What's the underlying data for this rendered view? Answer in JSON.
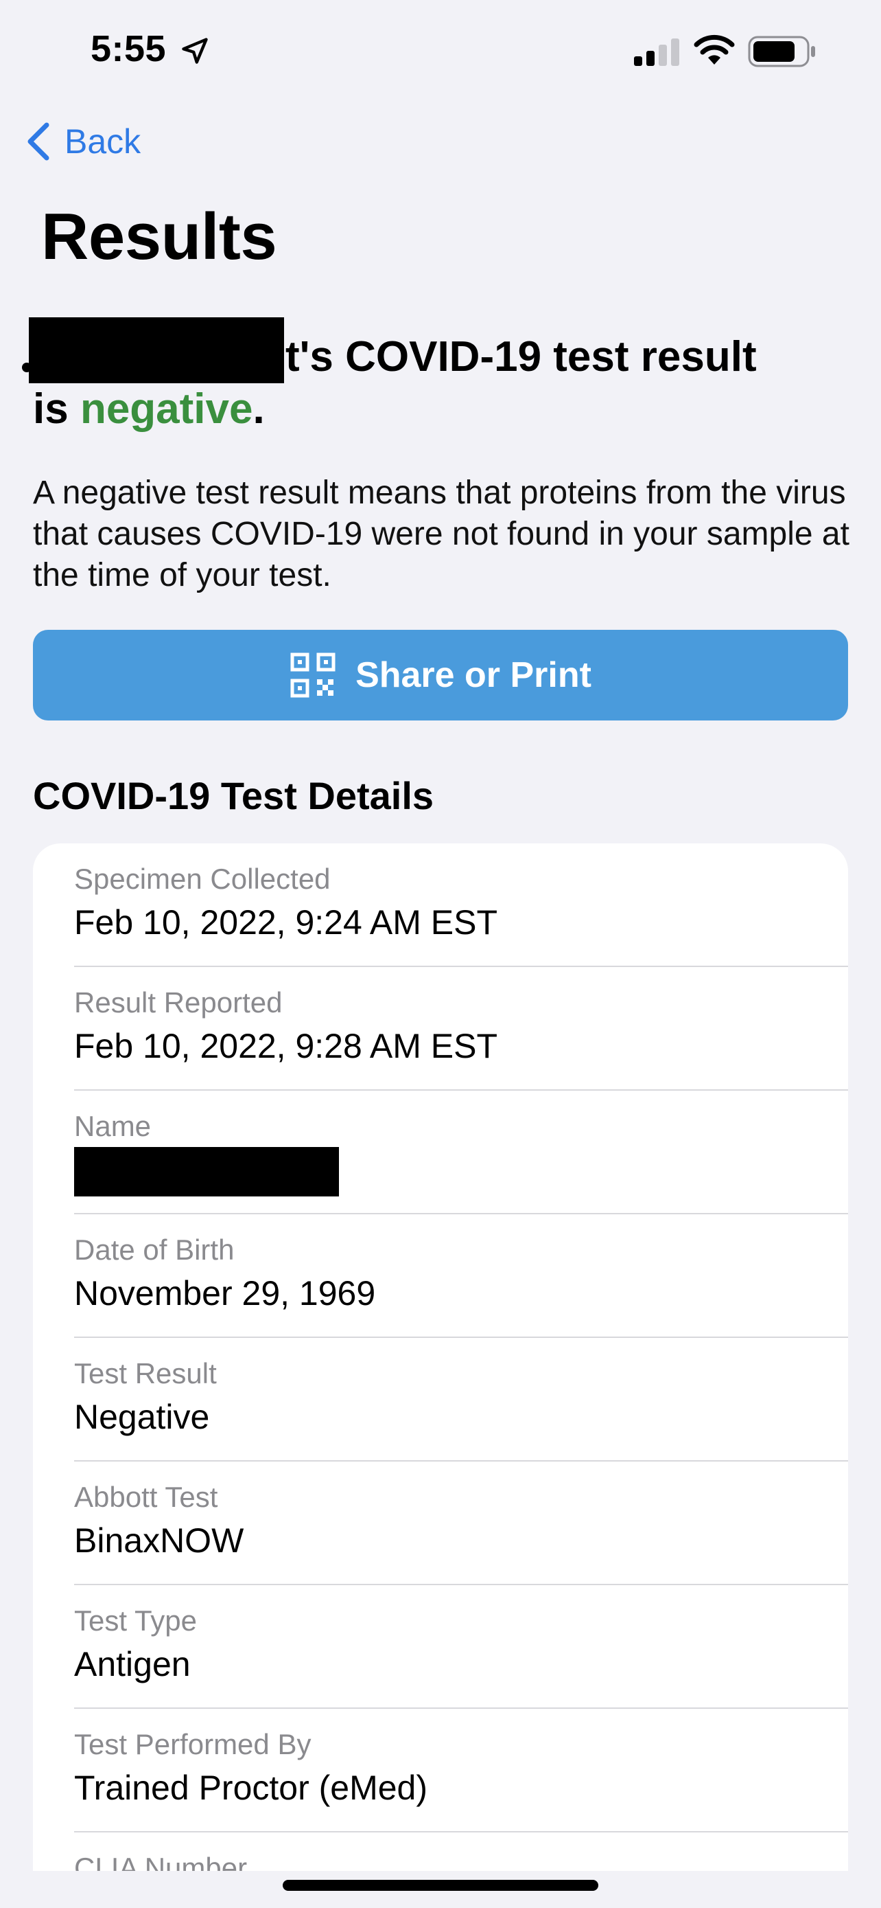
{
  "status_bar": {
    "time": "5:55",
    "icons": [
      "location-arrow-icon",
      "cellular-signal-icon",
      "wifi-icon",
      "battery-icon"
    ]
  },
  "nav": {
    "back_label": "Back"
  },
  "page_title": "Results",
  "result": {
    "headline_rest": "t's COVID-19 test result",
    "is_word": "is",
    "status_word": "negative",
    "period": ".",
    "description": "A negative test result means that proteins from the virus that causes COVID-19 were not found in your sample at the time of your test."
  },
  "share_button": {
    "label": "Share or Print",
    "icon": "qr-code-icon"
  },
  "details": {
    "title": "COVID-19 Test Details",
    "rows": [
      {
        "label": "Specimen Collected",
        "value": "Feb 10, 2022, 9:24 AM EST"
      },
      {
        "label": "Result Reported",
        "value": "Feb 10, 2022, 9:28 AM EST"
      },
      {
        "label": "Name",
        "value": ""
      },
      {
        "label": "Date of Birth",
        "value": "November 29, 1969"
      },
      {
        "label": "Test Result",
        "value": "Negative"
      },
      {
        "label": "Abbott Test",
        "value": "BinaxNOW"
      },
      {
        "label": "Test Type",
        "value": "Antigen"
      },
      {
        "label": "Test Performed By",
        "value": "Trained Proctor (eMed)"
      },
      {
        "label": "CLIA Number",
        "value": ""
      }
    ]
  },
  "colors": {
    "accent_blue": "#2f7ae5",
    "button_blue": "#4a9bdc",
    "negative_green": "#3a8f3e",
    "background": "#f2f2f7"
  }
}
